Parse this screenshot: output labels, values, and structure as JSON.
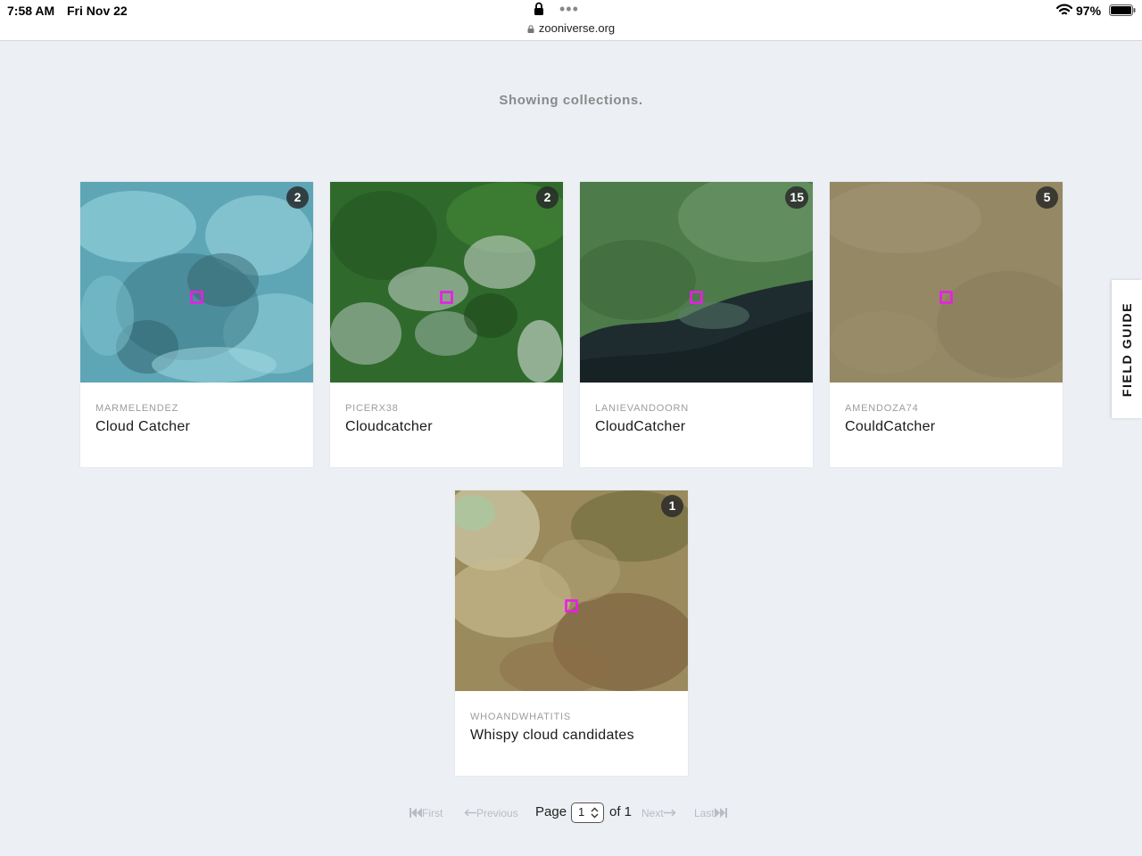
{
  "status_bar": {
    "time": "7:58 AM",
    "date": "Fri Nov 22",
    "dots": "•••",
    "url": "zooniverse.org",
    "battery_pct": "97%"
  },
  "showing_text": "Showing collections.",
  "collections": [
    {
      "owner": "MARMELENDEZ",
      "name": "Cloud Catcher",
      "count": "2"
    },
    {
      "owner": "PICERX38",
      "name": "Cloudcatcher",
      "count": "2"
    },
    {
      "owner": "LANIEVANDOORN",
      "name": "CloudCatcher",
      "count": "15"
    },
    {
      "owner": "AMENDOZA74",
      "name": "CouldCatcher",
      "count": "5"
    },
    {
      "owner": "WHOANDWHATITIS",
      "name": "Whispy cloud candidates",
      "count": "1"
    }
  ],
  "field_guide": "FIELD GUIDE",
  "pagination": {
    "first": "First",
    "previous": "Previous",
    "page_label": "Page",
    "page_value": "1",
    "of_label": "of 1",
    "next": "Next",
    "last": "Last"
  },
  "colors": {
    "marker": "#e91ee5",
    "badge": "#2a2a2a",
    "background": "#eceff4"
  }
}
